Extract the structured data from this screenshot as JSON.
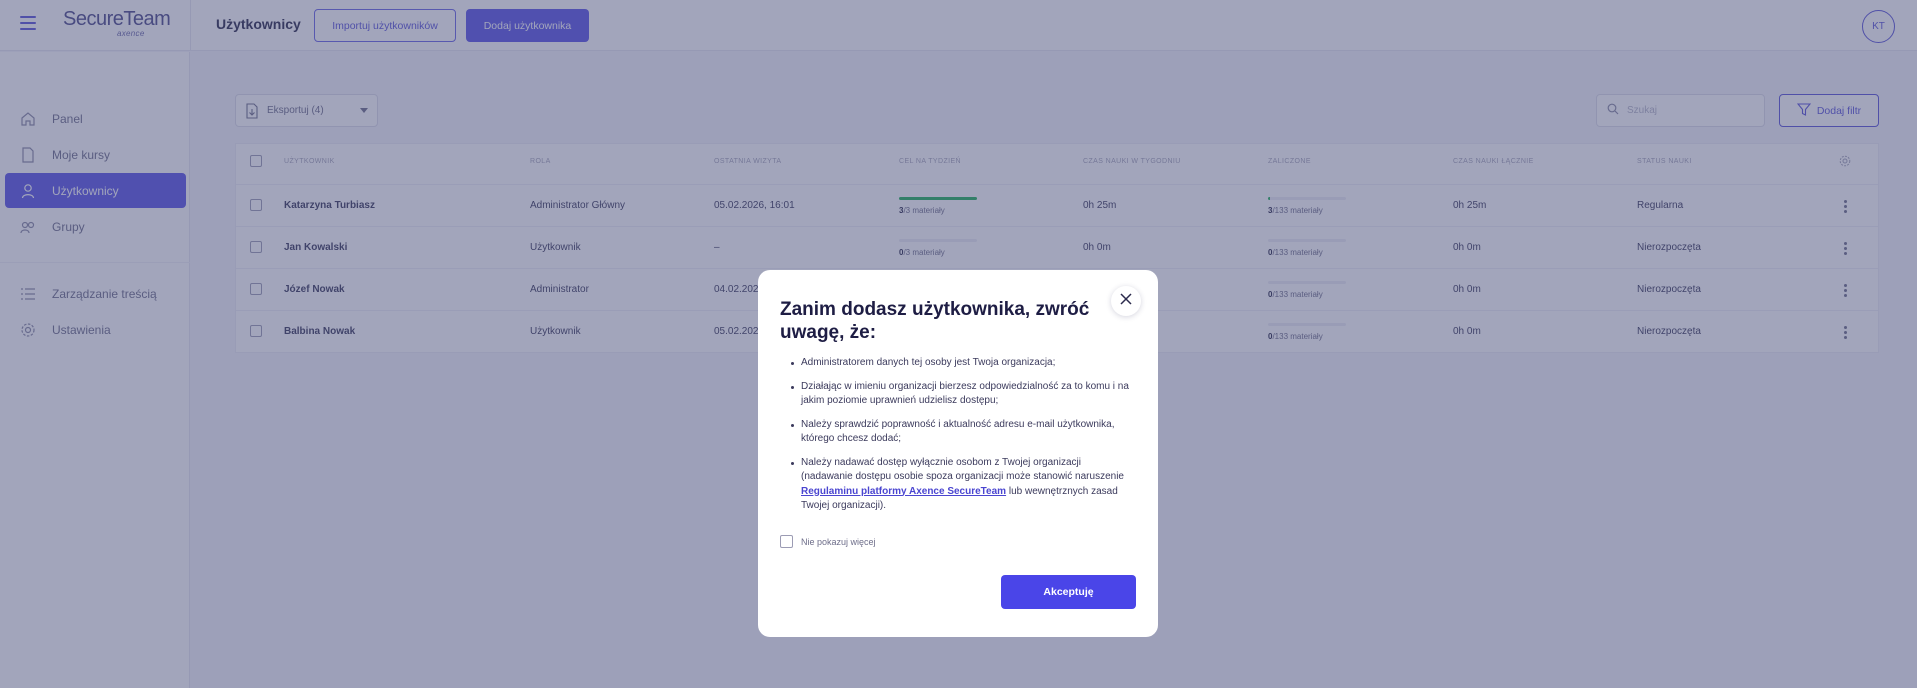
{
  "app": {
    "logo_text": "SecureTeam",
    "logo_sub": "axence"
  },
  "header": {
    "title": "Użytkownicy",
    "import_label": "Importuj użytkowników",
    "add_label": "Dodaj użytkownika",
    "avatar_initials": "KT"
  },
  "sidebar": {
    "items": [
      {
        "label": "Panel",
        "icon": "home-icon",
        "active": false
      },
      {
        "label": "Moje kursy",
        "icon": "document-icon",
        "active": false
      },
      {
        "label": "Użytkownicy",
        "icon": "user-icon",
        "active": true
      },
      {
        "label": "Grupy",
        "icon": "group-icon",
        "active": false
      },
      {
        "label": "Zarządzanie treścią",
        "icon": "list-icon",
        "active": false
      },
      {
        "label": "Ustawienia",
        "icon": "gear-icon",
        "active": false
      }
    ]
  },
  "toolbar": {
    "export_label": "Eksportuj (4)",
    "search_placeholder": "Szukaj",
    "filter_label": "Dodaj filtr"
  },
  "table": {
    "columns": [
      "Użytkownik",
      "Rola",
      "Ostatnia wizyta",
      "Cel na tydzień",
      "Czas nauki w tygodniu",
      "Zaliczone",
      "Czas nauki łącznie",
      "Status nauki"
    ],
    "rows": [
      {
        "user": "Katarzyna Turbiasz",
        "role": "Administrator Główny",
        "last_visit": "05.02.2026, 16:01",
        "goal_done": "3",
        "goal_total": "/3 materiały",
        "goal_fraction": 1.0,
        "week_time": "0h 25m",
        "passed_done": "3",
        "passed_total": "/133 materiały",
        "passed_fraction": 0.0226,
        "total_time": "0h 25m",
        "status": "Regularna"
      },
      {
        "user": "Jan Kowalski",
        "role": "Użytkownik",
        "last_visit": "–",
        "goal_done": "0",
        "goal_total": "/3 materiały",
        "goal_fraction": 0.0,
        "week_time": "0h 0m",
        "passed_done": "0",
        "passed_total": "/133 materiały",
        "passed_fraction": 0.0,
        "total_time": "0h 0m",
        "status": "Nierozpoczęta"
      },
      {
        "user": "Józef Nowak",
        "role": "Administrator",
        "last_visit": "04.02.202",
        "goal_done": "",
        "goal_total": "",
        "goal_fraction": 0.0,
        "week_time": "",
        "passed_done": "0",
        "passed_total": "/133 materiały",
        "passed_fraction": 0.0,
        "total_time": "0h 0m",
        "status": "Nierozpoczęta"
      },
      {
        "user": "Balbina Nowak",
        "role": "Użytkownik",
        "last_visit": "05.02.202",
        "goal_done": "",
        "goal_total": "",
        "goal_fraction": 0.0,
        "week_time": "",
        "passed_done": "0",
        "passed_total": "/133 materiały",
        "passed_fraction": 0.0,
        "total_time": "0h 0m",
        "status": "Nierozpoczęta"
      }
    ]
  },
  "modal": {
    "title": "Zanim dodasz użytkownika, zwróć uwagę, że:",
    "items": [
      "Administratorem danych tej osoby jest Twoja organizacja;",
      "Działając w imieniu organizacji bierzesz odpowiedzialność za to komu i na jakim poziomie uprawnień udzielisz dostępu;",
      "Należy sprawdzić poprawność i aktualność adresu e-mail użytkownika, którego chcesz dodać;"
    ],
    "last_item_prefix": "Należy nadawać dostęp wyłącznie osobom z Twojej organizacji (nadawanie dostępu osobie spoza organizacji może stanowić naruszenie ",
    "last_item_link": "Regulaminu platformy Axence SecureTeam",
    "last_item_suffix": " lub wewnętrznych zasad Twojej organizacji).",
    "dont_show_label": "Nie pokazuj więcej",
    "accept_label": "Akceptuję"
  },
  "colors": {
    "accent": "#5a55e6",
    "progress": "#21b35a",
    "overlay": "#464b78"
  }
}
